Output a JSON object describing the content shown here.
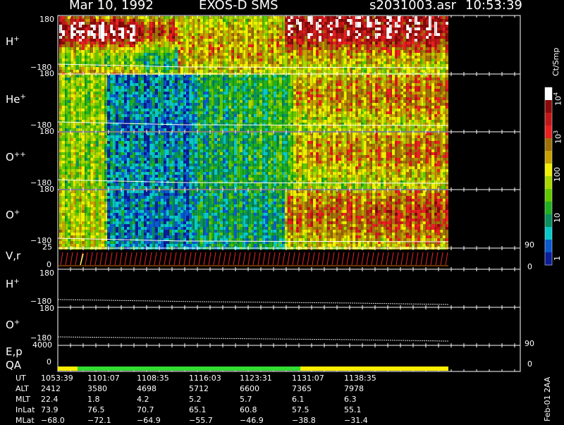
{
  "header": {
    "date": "Mar 10, 1992",
    "mission": "EXOS-D SMS",
    "file": "s2031003.asr",
    "time": "10:53:39"
  },
  "colors": {
    "axis": "#ffffff",
    "trace": "#ffffff",
    "qa_green": "#33dd33",
    "qa_yellow": "#ffee00",
    "vr_red": "#ee2222"
  },
  "chart_data": {
    "type": "heatmap",
    "panels": [
      {
        "name": "H",
        "superscript": "+",
        "ylim": [
          -180,
          180
        ],
        "tick_labels": [
          "180",
          "−180"
        ],
        "kind": "spectrogram"
      },
      {
        "name": "He",
        "superscript": "+",
        "ylim": [
          -180,
          180
        ],
        "tick_labels": [
          "180",
          "−180"
        ],
        "kind": "spectrogram"
      },
      {
        "name": "O",
        "superscript": "++",
        "ylim": [
          -180,
          180
        ],
        "tick_labels": [
          "180",
          "−180"
        ],
        "kind": "spectrogram"
      },
      {
        "name": "O",
        "superscript": "+",
        "ylim": [
          -180,
          180
        ],
        "tick_labels": [
          "180",
          "−180"
        ],
        "kind": "spectrogram",
        "right_tick": "90"
      },
      {
        "name": "V,r",
        "superscript": "",
        "ylim": [
          0,
          25
        ],
        "tick_labels": [
          "25",
          "0"
        ],
        "kind": "velocity",
        "right_ticks": [
          "90",
          "0"
        ]
      },
      {
        "name": "H",
        "superscript": "+",
        "ylim": [
          -180,
          180
        ],
        "tick_labels": [
          "180",
          "−180"
        ],
        "kind": "trace"
      },
      {
        "name": "O",
        "superscript": "+",
        "ylim": [
          -180,
          180
        ],
        "tick_labels": [
          "180",
          "−180"
        ],
        "kind": "trace"
      },
      {
        "name": "E,p",
        "superscript": "",
        "ylim": [
          0,
          4000
        ],
        "tick_labels": [
          "4000",
          "0"
        ],
        "kind": "trace",
        "right_ticks": [
          "90",
          "0"
        ]
      },
      {
        "name": "QA",
        "superscript": "",
        "kind": "qa"
      }
    ],
    "colorbar": {
      "title": "Ct/Smp",
      "labels": [
        "1",
        "10",
        "100",
        "10",
        "10"
      ],
      "exponents": [
        "",
        "",
        "",
        "3",
        "4"
      ],
      "colors": [
        "#ffffff",
        "#8a0a0a",
        "#c01818",
        "#e82020",
        "#a07008",
        "#c8a000",
        "#f0f000",
        "#a8d800",
        "#60c800",
        "#20b020",
        "#089060",
        "#08c8c8",
        "#0a5ad0",
        "#0a1e9a"
      ]
    },
    "qa_segments": [
      {
        "from": "1053:39",
        "to": "1101:07",
        "color": "yellow"
      },
      {
        "from": "1101:07",
        "to": "1123:31",
        "color": "green"
      },
      {
        "from": "1123:31",
        "to": "1141:30",
        "color": "yellow"
      }
    ],
    "ephemeris": {
      "row_labels": [
        "UT",
        "ALT",
        "MLT",
        "InLat",
        "MLat"
      ],
      "columns": [
        {
          "UT": "1053:39",
          "ALT": "2412",
          "MLT": "22.4",
          "InLat": "73.9",
          "MLat": "−68.0"
        },
        {
          "UT": "1101:07",
          "ALT": "3580",
          "MLT": "1.8",
          "InLat": "76.5",
          "MLat": "−72.1"
        },
        {
          "UT": "1108:35",
          "ALT": "4698",
          "MLT": "4.2",
          "InLat": "70.7",
          "MLat": "−64.9"
        },
        {
          "UT": "1116:03",
          "ALT": "5712",
          "MLT": "5.2",
          "InLat": "65.1",
          "MLat": "−55.7"
        },
        {
          "UT": "1123:31",
          "ALT": "6600",
          "MLT": "5.7",
          "InLat": "60.8",
          "MLat": "−46.9"
        },
        {
          "UT": "1131:07",
          "ALT": "7365",
          "MLT": "6.1",
          "InLat": "57.5",
          "MLat": "−38.8"
        },
        {
          "UT": "1138:35",
          "ALT": "7978",
          "MLT": "6.3",
          "InLat": "55.1",
          "MLat": "−31.4"
        }
      ]
    },
    "footer": "Feb-01 2AA"
  }
}
